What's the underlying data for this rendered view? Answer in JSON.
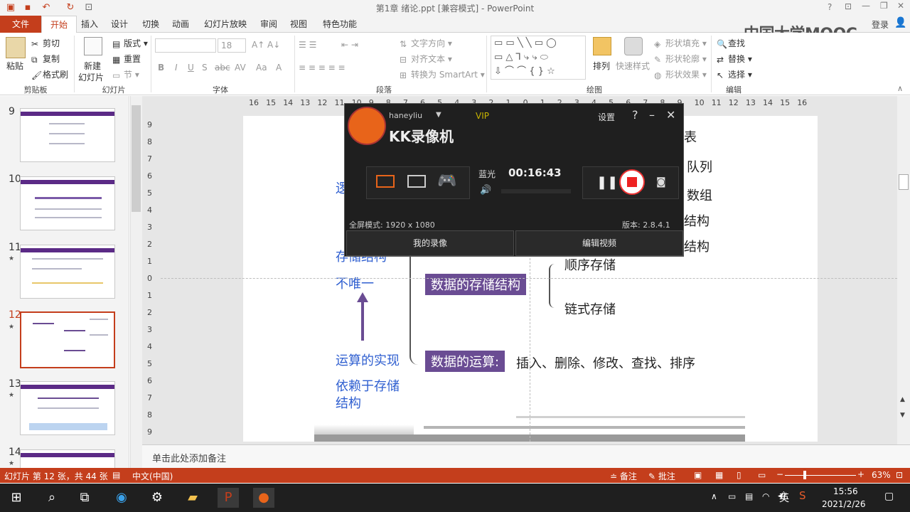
{
  "window": {
    "title": "第1章 绪论.ppt [兼容模式] - PowerPoint"
  },
  "quick_access": {
    "save": "save-icon",
    "undo": "undo-icon",
    "redo": "redo-icon"
  },
  "window_controls": {
    "help": "?",
    "account": "登录"
  },
  "tabs": [
    {
      "label": "文件"
    },
    {
      "label": "开始"
    },
    {
      "label": "插入"
    },
    {
      "label": "设计"
    },
    {
      "label": "切换"
    },
    {
      "label": "动画"
    },
    {
      "label": "幻灯片放映"
    },
    {
      "label": "审阅"
    },
    {
      "label": "视图"
    },
    {
      "label": "特色功能"
    }
  ],
  "watermark": "中国大学MOOC",
  "ribbon": {
    "clipboard": {
      "paste": "粘贴",
      "cut": "剪切",
      "copy": "复制",
      "format_painter": "格式刷",
      "group": "剪贴板"
    },
    "slides": {
      "new_slide_1": "新建",
      "new_slide_2": "幻灯片",
      "layout": "版式",
      "reset": "重置",
      "section": "节",
      "group": "幻灯片"
    },
    "font": {
      "size": "18",
      "bold": "B",
      "italic": "I",
      "underline": "U",
      "shadow": "S",
      "strike": "abc",
      "spacing": "AV",
      "case": "Aa",
      "color": "A",
      "group": "字体"
    },
    "paragraph": {
      "direction": "文字方向",
      "align": "对齐文本",
      "smartart": "转换为 SmartArt",
      "group": "段落"
    },
    "drawing": {
      "arrange": "排列",
      "quick_styles": "快速样式",
      "fill": "形状填充",
      "outline": "形状轮廓",
      "effects": "形状效果",
      "group": "绘图"
    },
    "editing": {
      "find": "查找",
      "replace": "替换",
      "select": "选择",
      "group": "编辑"
    }
  },
  "thumbnails": [
    {
      "num": "9",
      "star": ""
    },
    {
      "num": "10",
      "star": ""
    },
    {
      "num": "11",
      "star": "★"
    },
    {
      "num": "12",
      "star": "★"
    },
    {
      "num": "13",
      "star": "★"
    },
    {
      "num": "14",
      "star": "★"
    }
  ],
  "ruler_h": [
    "16",
    "15",
    "14",
    "13",
    "12",
    "11",
    "10",
    "9",
    "8",
    "7",
    "6",
    "5",
    "4",
    "3",
    "2",
    "1",
    "0",
    "1",
    "2",
    "3",
    "4",
    "5",
    "6",
    "7",
    "8",
    "9",
    "10",
    "11",
    "12",
    "13",
    "14",
    "15",
    "16"
  ],
  "ruler_v": [
    "9",
    "8",
    "7",
    "6",
    "5",
    "4",
    "3",
    "2",
    "1",
    "0",
    "1",
    "2",
    "3",
    "4",
    "5",
    "6",
    "7",
    "8",
    "9"
  ],
  "slide": {
    "left_top_1": "逻",
    "left_storage": "存储结构",
    "left_not_unique": "不唯一",
    "left_op_impl": "运算的实现",
    "left_depend_1": "依赖于存储",
    "left_depend_2": "结构",
    "right_list": "表",
    "right_queue": "队列",
    "right_array": "数组",
    "right_struct1": "结构",
    "right_struct2": "结构",
    "storage_box": "数据的存储结构",
    "sequential": "顺序存储",
    "linked": "链式存储",
    "ops_box": "数据的运算:",
    "ops_list": "插入、删除、修改、查找、排序"
  },
  "recorder": {
    "user": "haneyliu",
    "vip": "VIP",
    "logo": "KK录像机",
    "settings": "设置",
    "help": "?",
    "quality": "蓝光",
    "timer": "00:16:43",
    "mode": "全屏模式: 1920 x 1080",
    "version": "版本: 2.8.4.1",
    "my_recordings": "我的录像",
    "edit_video": "编辑视频"
  },
  "notes": {
    "placeholder": "单击此处添加备注"
  },
  "status": {
    "slide_info": "幻灯片 第 12 张，共 44 张",
    "language": "中文(中国)",
    "notes": "备注",
    "comments": "批注",
    "zoom": "63%"
  },
  "taskbar": {
    "time": "15:56",
    "date": "2021/2/26",
    "ime": "英"
  },
  "colors": {
    "accent": "#c43e1c",
    "slide_purple": "#6a4c93",
    "slide_blue": "#2f5fd0"
  }
}
